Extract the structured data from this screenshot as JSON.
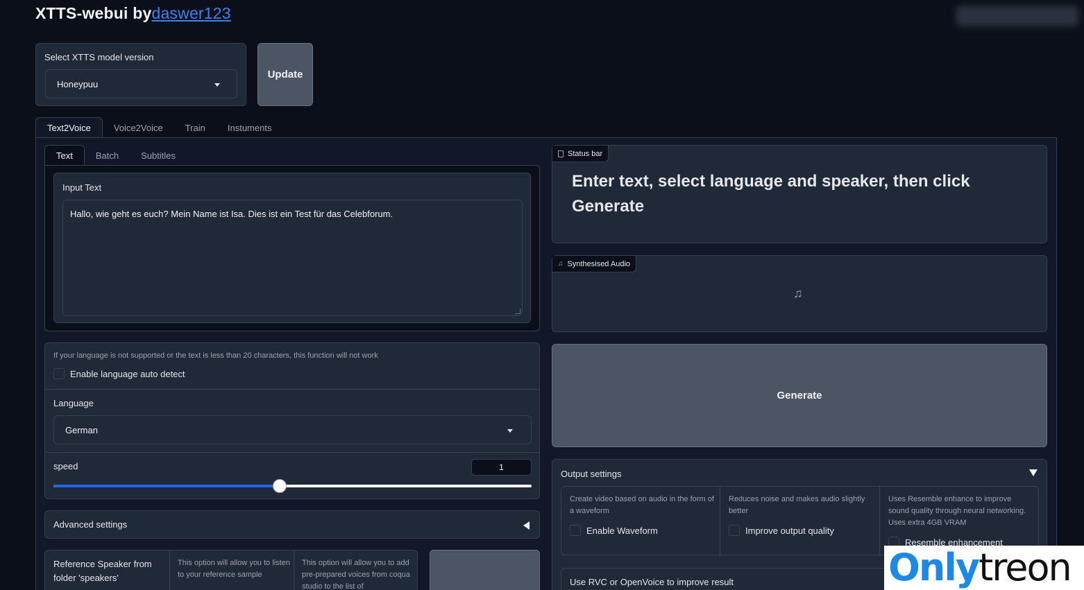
{
  "header": {
    "title_prefix": "XTTS-webui by",
    "author_link": "daswer123"
  },
  "model": {
    "label": "Select XTTS model version",
    "selected": "Honeypuu",
    "update_button": "Update"
  },
  "main_tabs": [
    "Text2Voice",
    "Voice2Voice",
    "Train",
    "Instuments"
  ],
  "sub_tabs": [
    "Text",
    "Batch",
    "Subtitles"
  ],
  "input_text": {
    "label": "Input Text",
    "value": "Hallo, wie geht es euch? Mein Name ist Isa. Dies ist ein Test für das Celebforum."
  },
  "language": {
    "note": "If your language is not supported or the text is less than 20 characters, this function will not work",
    "auto_detect_label": "Enable language auto detect",
    "label": "Language",
    "selected": "German"
  },
  "speed": {
    "label": "speed",
    "value": "1",
    "fraction": 0.5
  },
  "advanced": {
    "label": "Advanced settings"
  },
  "speaker": {
    "label": "Reference Speaker from folder 'speakers'",
    "note1": "This option will allow you to listen to your reference sample",
    "note2": "This option will allow you to add pre-prepared voices from coqua studio to the list of"
  },
  "status_bar": {
    "label": "Status bar",
    "message": "Enter text, select language and speaker, then click Generate"
  },
  "audio": {
    "label": "Synthesised Audio"
  },
  "generate_button": "Generate",
  "output_settings": {
    "label": "Output settings",
    "options": [
      {
        "desc": "Create video based on audio in the form of a waveform",
        "label": "Enable Waveform"
      },
      {
        "desc": "Reduces noise and makes audio slightly better",
        "label": "Improve output quality"
      },
      {
        "desc": "Uses Resemble enhance to improve sound quality through neural networking. Uses extra 4GB VRAM",
        "label": "Resemble enhancement"
      }
    ],
    "rvc_label": "Use RVC or OpenVoice to improve result"
  },
  "watermark": {
    "part1": "Only",
    "part2": "treon"
  },
  "colors": {
    "background": "#0b0f19",
    "panel": "#1f2937",
    "accent": "#3b82f6",
    "button": "#4b5563"
  }
}
